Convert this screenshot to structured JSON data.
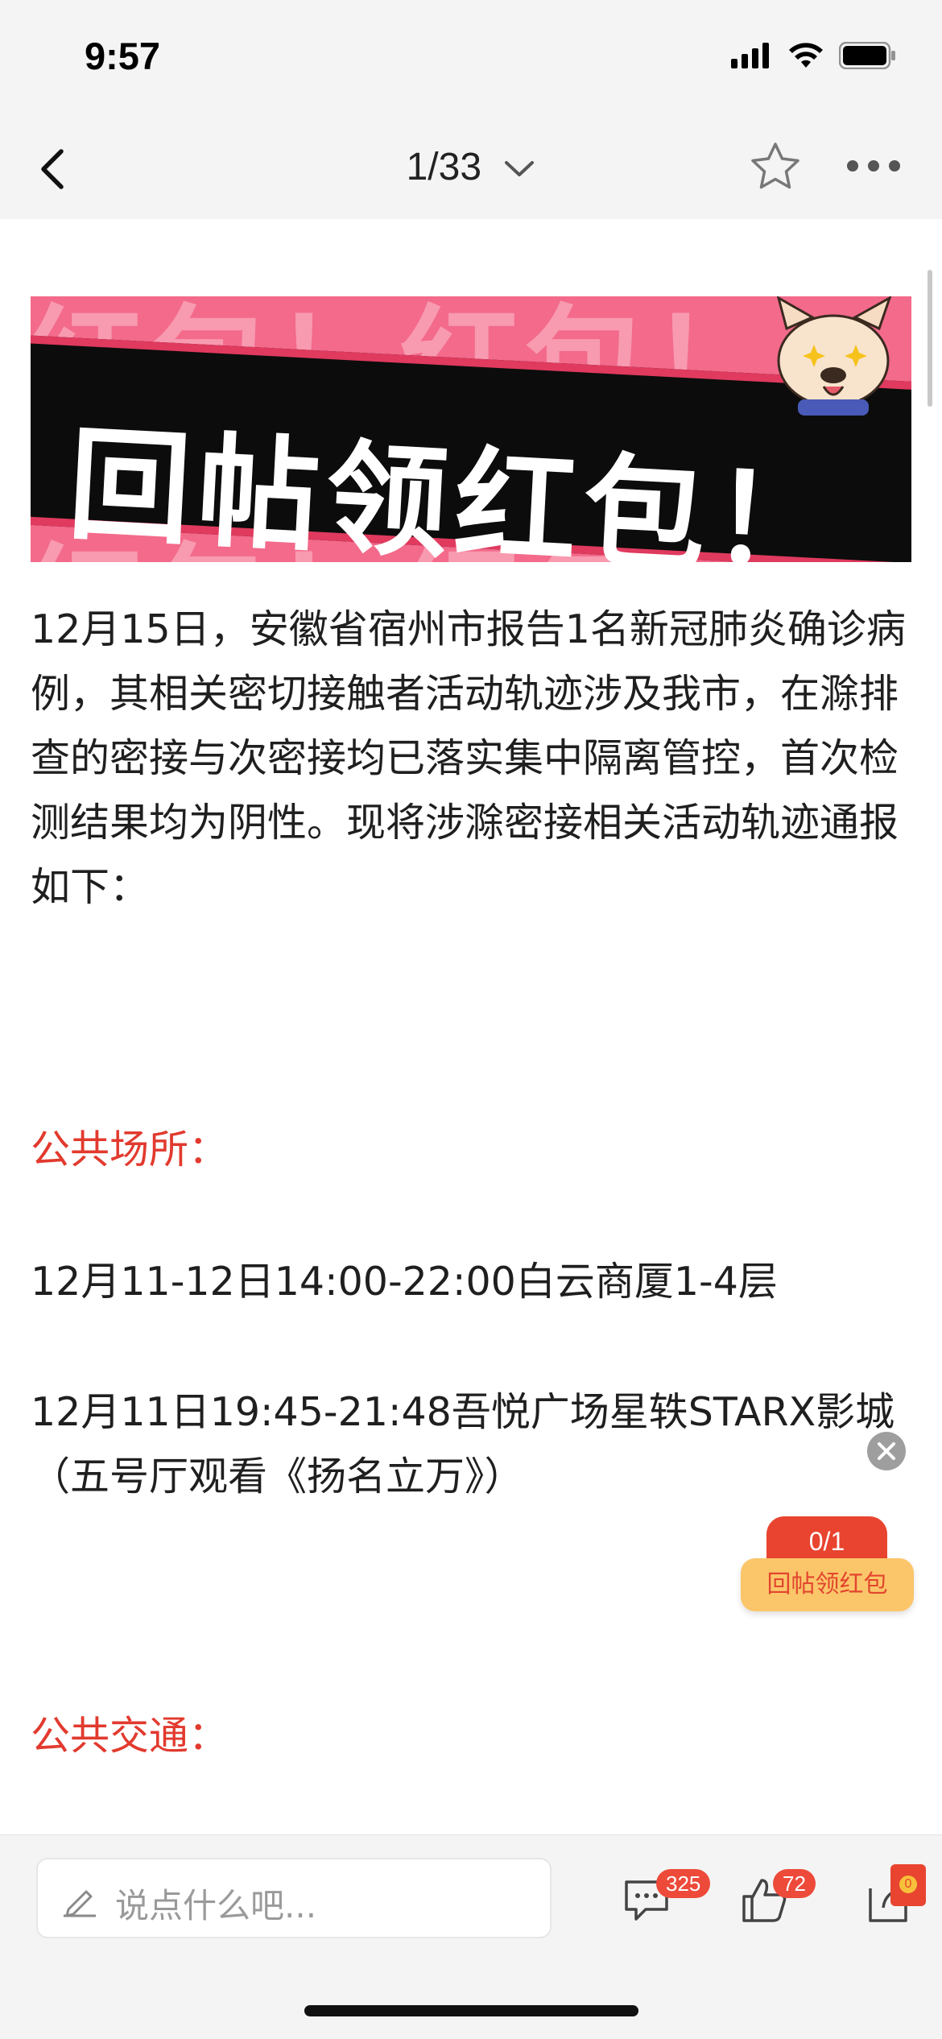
{
  "status": {
    "time": "9:57"
  },
  "nav": {
    "counter": "1/33"
  },
  "banner": {
    "title": "回帖领红包！",
    "bg_text": "红包！红包！"
  },
  "article": {
    "intro": "12月15日，安徽省宿州市报告1名新冠肺炎确诊病例，其相关密切接触者活动轨迹涉及我市，在滁排查的密接与次密接均已落实集中隔离管控，首次检测结果均为阴性。现将涉滁密接相关活动轨迹通报如下：",
    "section_public_places": "公共场所：",
    "item1": "12月11-12日14:00-22:00白云商厦1-4层",
    "item2": "12月11日19:45-21:48吾悦广场星轶STARX影城（五号厅观看《扬名立万》）",
    "section_public_transport": "公共交通："
  },
  "redpack": {
    "progress": "0/1",
    "label": "回帖领红包"
  },
  "bottom_bar": {
    "comment_placeholder": "说点什么吧...",
    "comment_count": "325",
    "like_count": "72",
    "share_badge": "0"
  },
  "icons": [
    "back-icon",
    "chevron-down-icon",
    "star-icon",
    "more-icon",
    "close-icon",
    "pen-icon",
    "comment-icon",
    "like-icon",
    "share-icon"
  ],
  "colors": {
    "accent_red": "#e23a2e",
    "badge_red": "#ed4a3a",
    "banner_pink": "#f36a8b"
  }
}
